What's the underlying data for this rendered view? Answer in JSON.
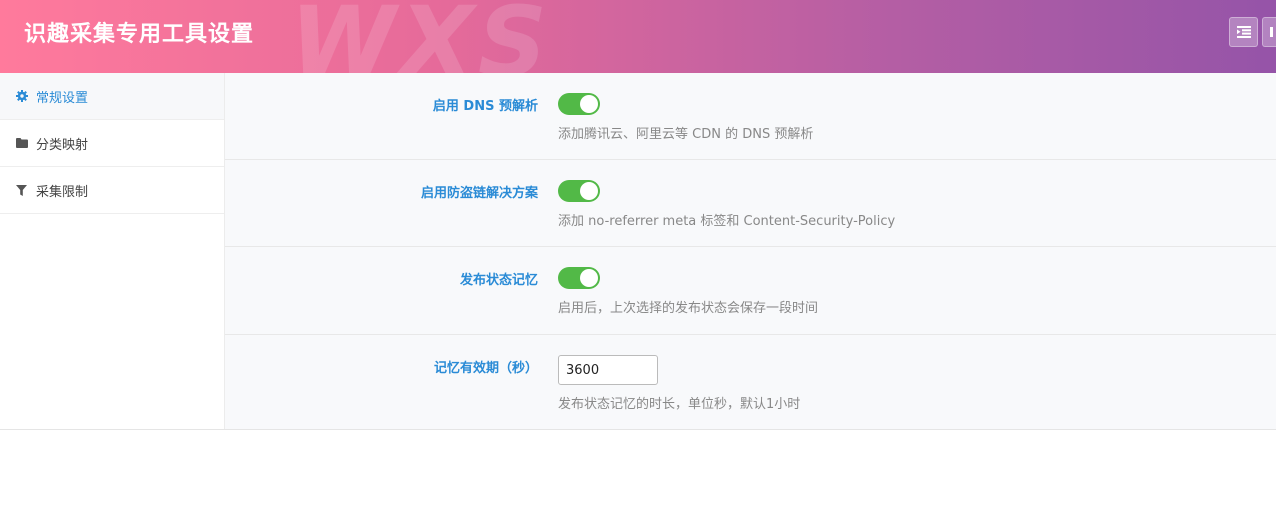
{
  "header": {
    "title": "识趣采集专用工具设置",
    "watermark": "WXS",
    "buttons": [
      {
        "icon": "menu-indent-icon"
      },
      {
        "icon": "partial-button-icon"
      }
    ]
  },
  "sidebar": {
    "items": [
      {
        "label": "常规设置",
        "icon": "gear-icon",
        "active": true
      },
      {
        "label": "分类映射",
        "icon": "folder-icon",
        "active": false
      },
      {
        "label": "采集限制",
        "icon": "filter-icon",
        "active": false
      }
    ]
  },
  "settings": {
    "dns": {
      "label": "启用 DNS 预解析",
      "enabled": true,
      "desc": "添加腾讯云、阿里云等 CDN 的 DNS 预解析"
    },
    "anti_hotlink": {
      "label": "启用防盗链解决方案",
      "enabled": true,
      "desc": "添加 no-referrer meta 标签和 Content-Security-Policy"
    },
    "remember_status": {
      "label": "发布状态记忆",
      "enabled": true,
      "desc": "启用后，上次选择的发布状态会保存一段时间"
    },
    "memory_ttl": {
      "label": "记忆有效期（秒）",
      "value": "3600",
      "desc": "发布状态记忆的时长，单位秒，默认1小时"
    }
  },
  "colors": {
    "accent": "#2a8bd6",
    "toggle_on": "#52b947",
    "header_start": "#ff7a9c",
    "header_end": "#9554a8"
  }
}
